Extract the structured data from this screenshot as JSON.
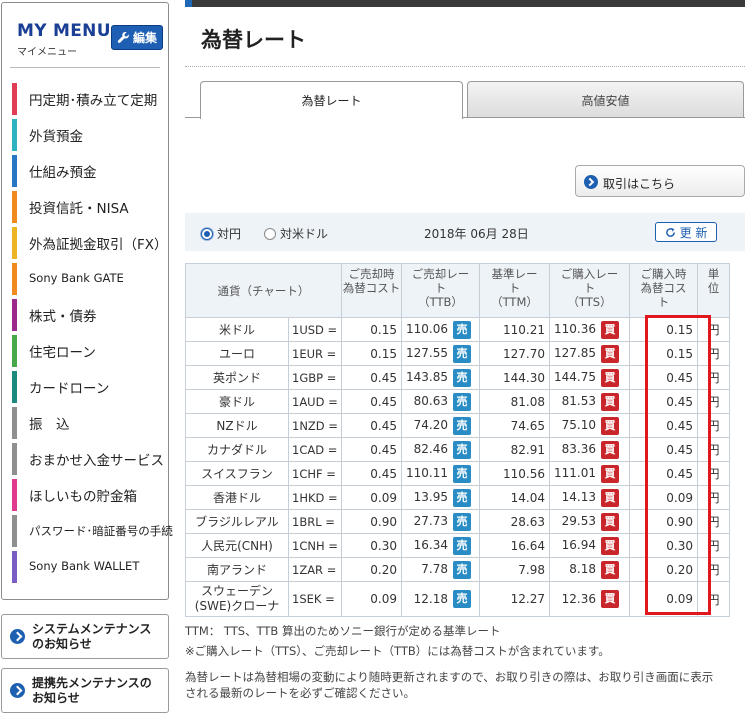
{
  "sidebar": {
    "title": "MY MENU",
    "subtitle": "マイメニュー",
    "edit_label": "編集",
    "items": [
      {
        "label": "円定期･積み立て定期",
        "color": "#e03c55"
      },
      {
        "label": "外貨預金",
        "color": "#2fb3c0"
      },
      {
        "label": "仕組み預金",
        "color": "#2577c4"
      },
      {
        "label": "投資信託・NISA",
        "color": "#f08a1e"
      },
      {
        "label": "外為証拠金取引（FX）",
        "color": "#eeb523"
      },
      {
        "label": "Sony Bank GATE",
        "color": "#f08a1e"
      },
      {
        "label": "株式・債券",
        "color": "#9c2a8c"
      },
      {
        "label": "住宅ローン",
        "color": "#46a848"
      },
      {
        "label": "カードローン",
        "color": "#1b8a7c"
      },
      {
        "label": "振　込",
        "color": "#8f8f8f"
      },
      {
        "label": "おまかせ入金サービス",
        "color": "#8f8f8f"
      },
      {
        "label": "ほしいもの貯金箱",
        "color": "#e03a8c"
      },
      {
        "label": "パスワード･暗証番号の手続",
        "color": "#8f8f8f"
      },
      {
        "label": "Sony Bank WALLET",
        "color": "#7b5bc4"
      }
    ],
    "notices": [
      {
        "line1": "システムメンテナンス",
        "line2": "のお知らせ"
      },
      {
        "line1": "提携先メンテナンスの",
        "line2": "お知らせ"
      }
    ]
  },
  "main": {
    "title": "為替レート",
    "tabs": [
      {
        "label": "為替レート",
        "active": true
      },
      {
        "label": "高値安値",
        "active": false
      }
    ],
    "trade_button": "取引はこちら",
    "filters": {
      "options": [
        {
          "label": "対円",
          "checked": true
        },
        {
          "label": "対米ドル",
          "checked": false
        }
      ],
      "date": "2018年 06月 28日",
      "refresh_label": "更 新"
    },
    "table": {
      "headers": {
        "currency": "通貨（チャート）",
        "sell_cost": [
          "ご売却時",
          "為替コスト"
        ],
        "ttb": [
          "ご売却レー",
          "ト",
          "（TTB）"
        ],
        "ttm": [
          "基準レー",
          "ト",
          "（TTM）"
        ],
        "tts": [
          "ご購入レー",
          "ト",
          "（TTS）"
        ],
        "buy_cost": [
          "ご購入時",
          "為替コス",
          "ト"
        ],
        "unit": [
          "単",
          "位"
        ]
      },
      "sell_badge": "売",
      "buy_badge": "買",
      "yen": "円",
      "rows": [
        {
          "name": [
            "米ドル"
          ],
          "unit": "1USD =",
          "sell_cost": "0.15",
          "ttb": "110.06",
          "ttm": "110.21",
          "tts": "110.36",
          "buy_cost": "0.15"
        },
        {
          "name": [
            "ユーロ"
          ],
          "unit": "1EUR =",
          "sell_cost": "0.15",
          "ttb": "127.55",
          "ttm": "127.70",
          "tts": "127.85",
          "buy_cost": "0.15"
        },
        {
          "name": [
            "英ポンド"
          ],
          "unit": "1GBP =",
          "sell_cost": "0.45",
          "ttb": "143.85",
          "ttm": "144.30",
          "tts": "144.75",
          "buy_cost": "0.45"
        },
        {
          "name": [
            "豪ドル"
          ],
          "unit": "1AUD =",
          "sell_cost": "0.45",
          "ttb": "80.63",
          "ttm": "81.08",
          "tts": "81.53",
          "buy_cost": "0.45"
        },
        {
          "name": [
            "NZドル"
          ],
          "unit": "1NZD =",
          "sell_cost": "0.45",
          "ttb": "74.20",
          "ttm": "74.65",
          "tts": "75.10",
          "buy_cost": "0.45"
        },
        {
          "name": [
            "カナダドル"
          ],
          "unit": "1CAD =",
          "sell_cost": "0.45",
          "ttb": "82.46",
          "ttm": "82.91",
          "tts": "83.36",
          "buy_cost": "0.45"
        },
        {
          "name": [
            "スイスフラン"
          ],
          "unit": "1CHF =",
          "sell_cost": "0.45",
          "ttb": "110.11",
          "ttm": "110.56",
          "tts": "111.01",
          "buy_cost": "0.45"
        },
        {
          "name": [
            "香港ドル"
          ],
          "unit": "1HKD =",
          "sell_cost": "0.09",
          "ttb": "13.95",
          "ttm": "14.04",
          "tts": "14.13",
          "buy_cost": "0.09"
        },
        {
          "name": [
            "ブラジルレアル"
          ],
          "unit": "1BRL =",
          "sell_cost": "0.90",
          "ttb": "27.73",
          "ttm": "28.63",
          "tts": "29.53",
          "buy_cost": "0.90"
        },
        {
          "name": [
            "人民元(CNH)"
          ],
          "unit": "1CNH =",
          "sell_cost": "0.30",
          "ttb": "16.34",
          "ttm": "16.64",
          "tts": "16.94",
          "buy_cost": "0.30"
        },
        {
          "name": [
            "南アランド"
          ],
          "unit": "1ZAR =",
          "sell_cost": "0.20",
          "ttb": "7.78",
          "ttm": "7.98",
          "tts": "8.18",
          "buy_cost": "0.20"
        },
        {
          "name": [
            "スウェーデン",
            "(SWE)クローナ"
          ],
          "unit": "1SEK =",
          "sell_cost": "0.09",
          "ttb": "12.18",
          "ttm": "12.27",
          "tts": "12.36",
          "buy_cost": "0.09"
        }
      ]
    },
    "notes": [
      "TTM： TTS、TTB 算出のためソニー銀行が定める基準レート",
      "※ご購入レート（TTS）、ご売却レート（TTB）には為替コストが含まれています。",
      "為替レートは為替相場の変動により随時更新されますので、お取り引きの際は、お取り引き画面に表示",
      "される最新のレートを必ずご確認ください。"
    ]
  }
}
